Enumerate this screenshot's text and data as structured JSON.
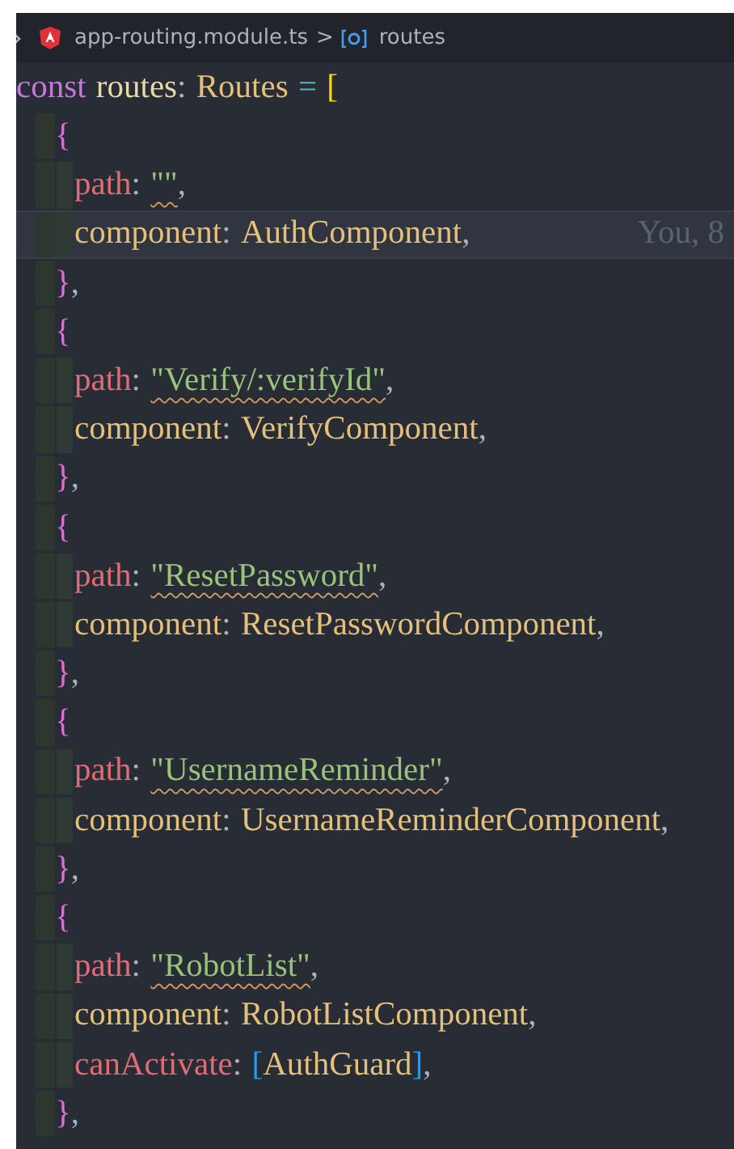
{
  "breadcrumb": {
    "file": "app-routing.module.ts",
    "separator": ">",
    "symbol": "routes"
  },
  "lines": [
    {
      "kind": "declaration",
      "current": false,
      "tokens": [
        {
          "kind": "keyword",
          "text": "const"
        },
        {
          "kind": "variable",
          "text": "routes"
        },
        {
          "kind": "punct",
          "text": ":"
        },
        {
          "kind": "type",
          "text": "Routes"
        },
        {
          "kind": "operator",
          "text": "="
        },
        {
          "kind": "bracket",
          "text": "["
        }
      ]
    },
    {
      "kind": "brace",
      "current": false,
      "tokens": [
        {
          "kind": "brace",
          "text": "{"
        }
      ]
    },
    {
      "kind": "property",
      "current": false,
      "tokens": [
        {
          "kind": "key",
          "text": "path"
        },
        {
          "kind": "punct",
          "text": ":"
        },
        {
          "kind": "string",
          "text": "\"\"",
          "squiggle": true
        },
        {
          "kind": "punct",
          "text": ","
        }
      ]
    },
    {
      "kind": "property",
      "current": true,
      "blame": "You, 8",
      "tokens": [
        {
          "kind": "field",
          "text": "component"
        },
        {
          "kind": "punct",
          "text": ":"
        },
        {
          "kind": "ident",
          "text": "AuthComponent"
        },
        {
          "kind": "punct",
          "text": ","
        }
      ]
    },
    {
      "kind": "brace",
      "current": false,
      "tokens": [
        {
          "kind": "brace",
          "text": "}"
        },
        {
          "kind": "punct",
          "text": ","
        }
      ]
    },
    {
      "kind": "brace",
      "current": false,
      "tokens": [
        {
          "kind": "brace",
          "text": "{"
        }
      ]
    },
    {
      "kind": "property",
      "current": false,
      "tokens": [
        {
          "kind": "key",
          "text": "path"
        },
        {
          "kind": "punct",
          "text": ":"
        },
        {
          "kind": "string",
          "text": "\"Verify/:verifyId\"",
          "squiggle": true
        },
        {
          "kind": "punct",
          "text": ","
        }
      ]
    },
    {
      "kind": "property",
      "current": false,
      "tokens": [
        {
          "kind": "field",
          "text": "component"
        },
        {
          "kind": "punct",
          "text": ":"
        },
        {
          "kind": "ident",
          "text": "VerifyComponent"
        },
        {
          "kind": "punct",
          "text": ","
        }
      ]
    },
    {
      "kind": "brace",
      "current": false,
      "tokens": [
        {
          "kind": "brace",
          "text": "}"
        },
        {
          "kind": "punct",
          "text": ","
        }
      ]
    },
    {
      "kind": "brace",
      "current": false,
      "tokens": [
        {
          "kind": "brace",
          "text": "{"
        }
      ]
    },
    {
      "kind": "property",
      "current": false,
      "tokens": [
        {
          "kind": "key",
          "text": "path"
        },
        {
          "kind": "punct",
          "text": ":"
        },
        {
          "kind": "string",
          "text": "\"ResetPassword\"",
          "squiggle": true
        },
        {
          "kind": "punct",
          "text": ","
        }
      ]
    },
    {
      "kind": "property",
      "current": false,
      "tokens": [
        {
          "kind": "field",
          "text": "component"
        },
        {
          "kind": "punct",
          "text": ":"
        },
        {
          "kind": "ident",
          "text": "ResetPasswordComponent"
        },
        {
          "kind": "punct",
          "text": ","
        }
      ]
    },
    {
      "kind": "brace",
      "current": false,
      "tokens": [
        {
          "kind": "brace",
          "text": "}"
        },
        {
          "kind": "punct",
          "text": ","
        }
      ]
    },
    {
      "kind": "brace",
      "current": false,
      "tokens": [
        {
          "kind": "brace",
          "text": "{"
        }
      ]
    },
    {
      "kind": "property",
      "current": false,
      "tokens": [
        {
          "kind": "key",
          "text": "path"
        },
        {
          "kind": "punct",
          "text": ":"
        },
        {
          "kind": "string",
          "text": "\"UsernameReminder\"",
          "squiggle": true
        },
        {
          "kind": "punct",
          "text": ","
        }
      ]
    },
    {
      "kind": "property",
      "current": false,
      "tokens": [
        {
          "kind": "field",
          "text": "component"
        },
        {
          "kind": "punct",
          "text": ":"
        },
        {
          "kind": "ident",
          "text": "UsernameReminderComponent"
        },
        {
          "kind": "punct",
          "text": ","
        }
      ]
    },
    {
      "kind": "brace",
      "current": false,
      "tokens": [
        {
          "kind": "brace",
          "text": "}"
        },
        {
          "kind": "punct",
          "text": ","
        }
      ]
    },
    {
      "kind": "brace",
      "current": false,
      "tokens": [
        {
          "kind": "brace",
          "text": "{"
        }
      ]
    },
    {
      "kind": "property",
      "current": false,
      "tokens": [
        {
          "kind": "key",
          "text": "path"
        },
        {
          "kind": "punct",
          "text": ":"
        },
        {
          "kind": "string",
          "text": "\"RobotList\"",
          "squiggle": true
        },
        {
          "kind": "punct",
          "text": ","
        }
      ]
    },
    {
      "kind": "property",
      "current": false,
      "tokens": [
        {
          "kind": "field",
          "text": "component"
        },
        {
          "kind": "punct",
          "text": ":"
        },
        {
          "kind": "ident",
          "text": "RobotListComponent"
        },
        {
          "kind": "punct",
          "text": ","
        }
      ]
    },
    {
      "kind": "property",
      "current": false,
      "tokens": [
        {
          "kind": "key",
          "text": "canActivate"
        },
        {
          "kind": "punct",
          "text": ":"
        },
        {
          "kind": "array_open",
          "text": "["
        },
        {
          "kind": "ident",
          "text": "AuthGuard"
        },
        {
          "kind": "array_close",
          "text": "]"
        },
        {
          "kind": "punct",
          "text": ","
        }
      ]
    },
    {
      "kind": "brace",
      "current": false,
      "tokens": [
        {
          "kind": "brace",
          "text": "}"
        },
        {
          "kind": "punct",
          "text": ","
        }
      ]
    }
  ]
}
